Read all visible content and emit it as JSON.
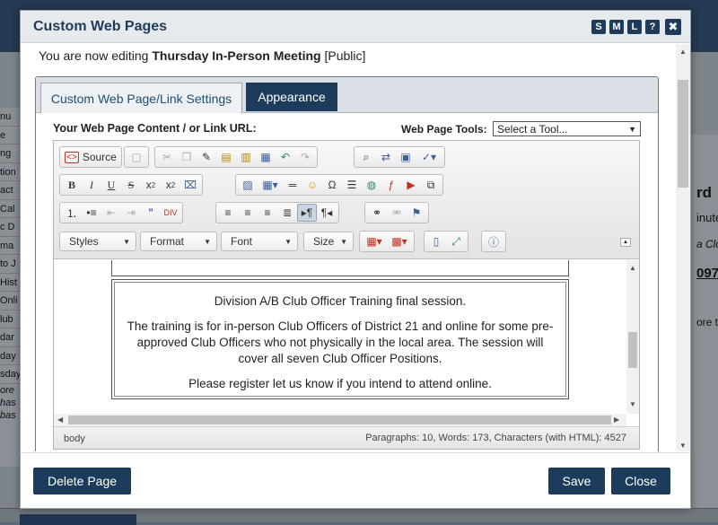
{
  "background": {
    "left_nav_items": [
      "nu",
      "e",
      "ng",
      "tion",
      "act",
      "Cal",
      "c D",
      "ma",
      "to J",
      "Hist",
      "Onli",
      "lub",
      "dar",
      "day",
      "sday"
    ],
    "left_nav_tail": [
      "ore",
      "has",
      "bas"
    ],
    "right_texts": [
      "rd",
      "inute",
      "a Clo",
      "097",
      "ore th"
    ]
  },
  "modal": {
    "title": "Custom Web Pages",
    "size_buttons": [
      "S",
      "M",
      "L",
      "?"
    ],
    "close_glyph": "✖"
  },
  "editing": {
    "prefix": "You are now editing ",
    "page_name": "Thursday In-Person Meeting",
    "visibility": "[Public]"
  },
  "tabs": [
    {
      "label": "Custom Web Page/Link Settings"
    },
    {
      "label": "Appearance"
    }
  ],
  "content": {
    "url_label": "Your Web Page Content / or Link URL:",
    "tools_label": "Web Page Tools:",
    "tools_select": "Select a Tool..."
  },
  "toolbar": {
    "source_label": "Source",
    "styles": "Styles",
    "format": "Format",
    "font": "Font",
    "size": "Size"
  },
  "editor_content": {
    "p1": "Division A/B Club Officer Training final session.",
    "p2": "The training is for in-person Club Officers of District 21 and online for some pre-approved Club Officers who not physically in the local area. The session will cover all seven Club Officer Positions.",
    "p3": "Please register let us know if you intend to attend online."
  },
  "status": {
    "path": "body",
    "counts": "Paragraphs: 10, Words: 173, Characters (with HTML): 4527"
  },
  "footer": {
    "delete_label": "Delete Page",
    "save_label": "Save",
    "close_label": "Close"
  },
  "colors": {
    "brand": "#1d3c5b",
    "accent_text": "#1d4f72"
  }
}
